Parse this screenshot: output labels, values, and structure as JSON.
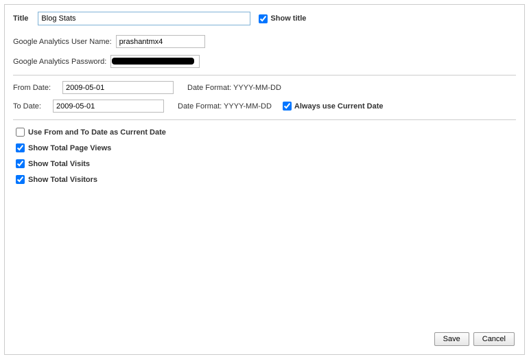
{
  "titleRow": {
    "label": "Title",
    "value": "Blog Stats",
    "showTitleLabel": "Show title"
  },
  "ga": {
    "userLabel": "Google Analytics User Name:",
    "userValue": "prashantmx4",
    "passLabel": "Google Analytics Password:"
  },
  "fromDate": {
    "label": "From Date:",
    "value": "2009-05-01",
    "formatLabel": "Date Format: YYYY-MM-DD"
  },
  "toDate": {
    "label": "To Date:",
    "value": "2009-05-01",
    "formatLabel": "Date Format: YYYY-MM-DD",
    "alwaysLabel": "Always use Current Date"
  },
  "options": {
    "useFromTo": "Use From and To Date as Current Date",
    "pageViews": "Show Total Page Views",
    "visits": "Show Total Visits",
    "visitors": "Show Total Visitors"
  },
  "buttons": {
    "save": "Save",
    "cancel": "Cancel"
  }
}
